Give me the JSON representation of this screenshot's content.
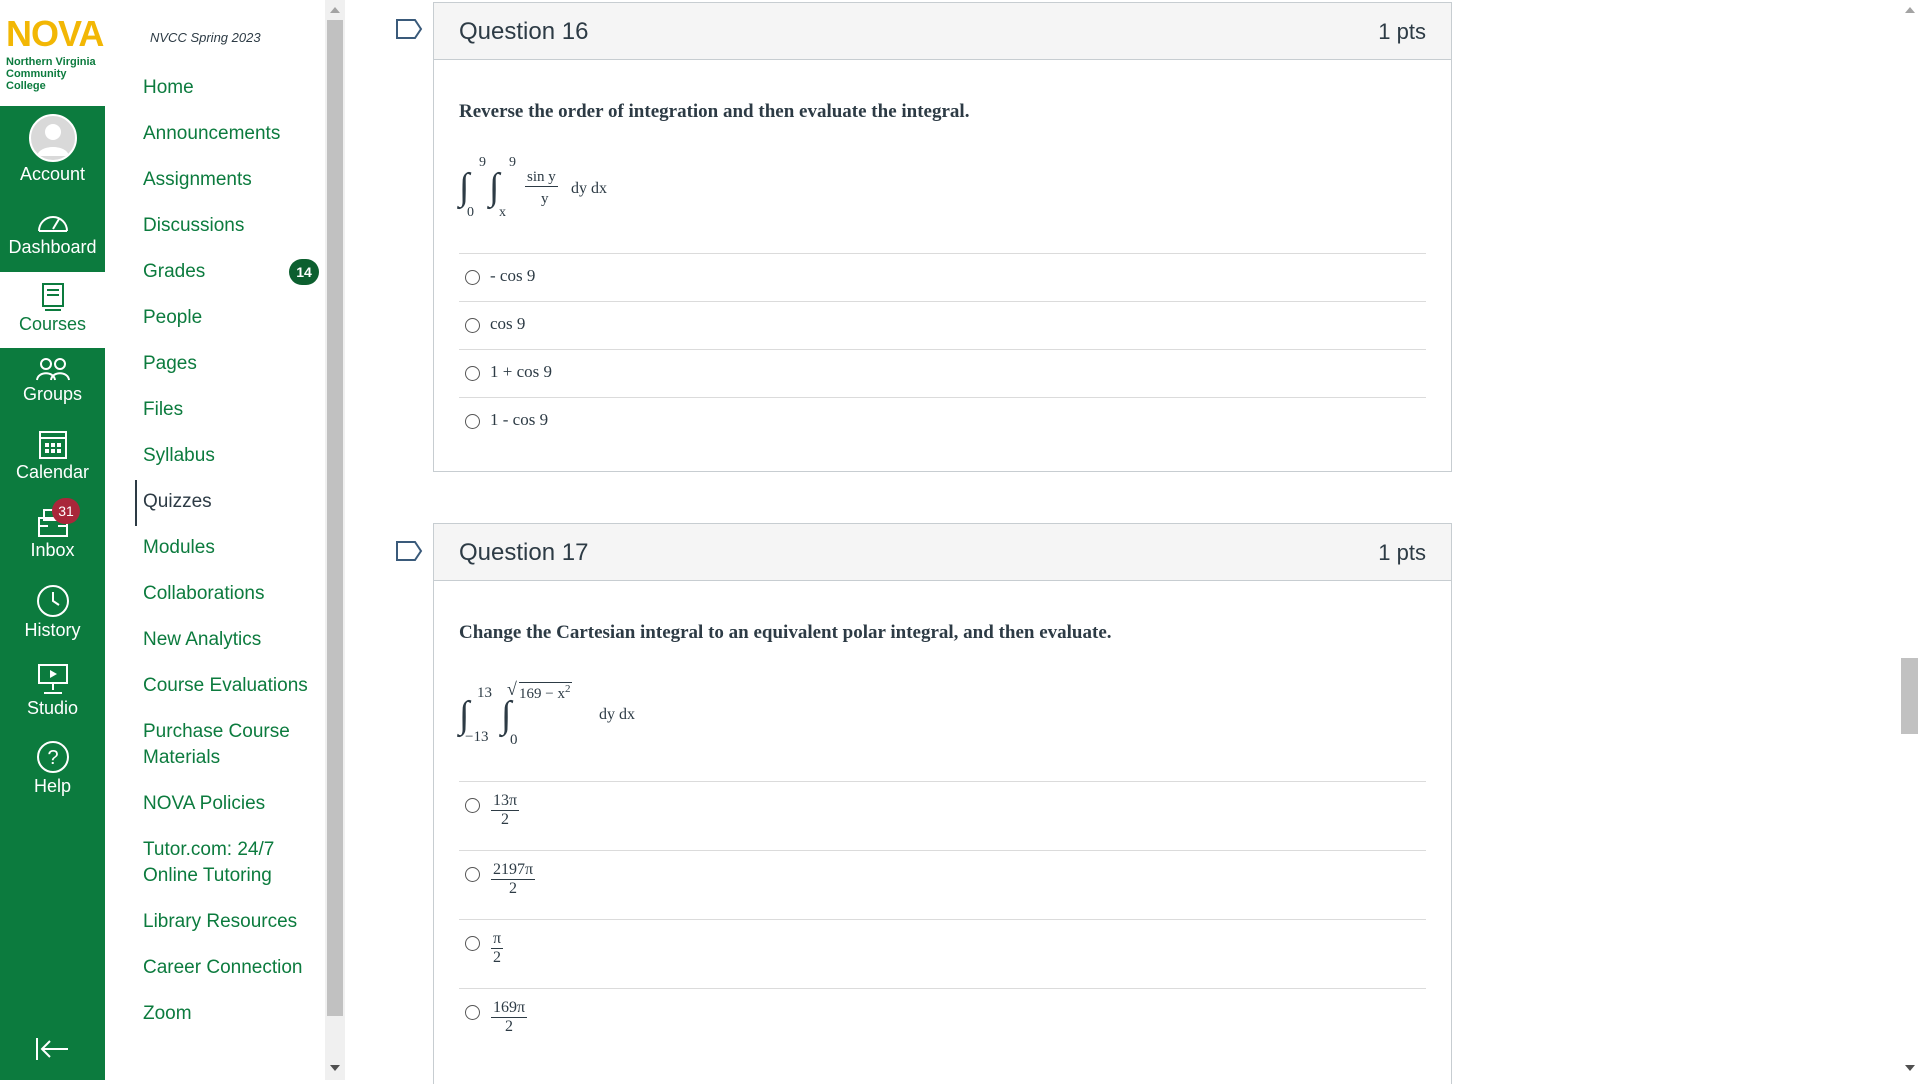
{
  "logo": {
    "name": "NOVA",
    "subtitle": "Northern Virginia Community College"
  },
  "global_nav": {
    "items": [
      {
        "label": "Account",
        "icon": "account-icon"
      },
      {
        "label": "Dashboard",
        "icon": "dashboard-icon"
      },
      {
        "label": "Courses",
        "icon": "courses-icon"
      },
      {
        "label": "Groups",
        "icon": "groups-icon"
      },
      {
        "label": "Calendar",
        "icon": "calendar-icon"
      },
      {
        "label": "Inbox",
        "icon": "inbox-icon",
        "badge": "31"
      },
      {
        "label": "History",
        "icon": "history-icon"
      },
      {
        "label": "Studio",
        "icon": "studio-icon"
      },
      {
        "label": "Help",
        "icon": "help-icon"
      }
    ]
  },
  "course_nav": {
    "term": "NVCC Spring 2023",
    "items": [
      {
        "label": "Home"
      },
      {
        "label": "Announcements"
      },
      {
        "label": "Assignments"
      },
      {
        "label": "Discussions"
      },
      {
        "label": "Grades",
        "badge": "14"
      },
      {
        "label": "People"
      },
      {
        "label": "Pages"
      },
      {
        "label": "Files"
      },
      {
        "label": "Syllabus"
      },
      {
        "label": "Quizzes"
      },
      {
        "label": "Modules"
      },
      {
        "label": "Collaborations"
      },
      {
        "label": "New Analytics"
      },
      {
        "label": "Course Evaluations"
      },
      {
        "label": "Purchase Course Materials"
      },
      {
        "label": "NOVA Policies"
      },
      {
        "label": "Tutor.com: 24/7 Online Tutoring"
      },
      {
        "label": "Library Resources"
      },
      {
        "label": "Career Connection"
      },
      {
        "label": "Zoom"
      }
    ]
  },
  "questions": [
    {
      "title": "Question 16",
      "points": "1 pts",
      "text": "Reverse the order of integration and then evaluate the integral.",
      "formula": {
        "outer_upper": "9",
        "outer_lower": "0",
        "inner_upper": "9",
        "inner_lower": "x",
        "numerator": "sin y",
        "denominator": "y",
        "differentials": "dy dx"
      },
      "answers": [
        "- cos 9",
        "cos 9",
        "1 + cos 9",
        "1 - cos 9"
      ]
    },
    {
      "title": "Question 17",
      "points": "1 pts",
      "text": "Change the Cartesian integral to an equivalent polar integral, and then evaluate.",
      "formula": {
        "outer_upper": "13",
        "outer_lower": "−13",
        "inner_upper": "169 − x",
        "inner_upper_exp": "2",
        "inner_lower": "0",
        "differentials": "dy dx"
      },
      "answers": [
        {
          "num": "13π",
          "den": "2"
        },
        {
          "num": "2197π",
          "den": "2"
        },
        {
          "num": "π",
          "den": "2"
        },
        {
          "num": "169π",
          "den": "2"
        }
      ]
    }
  ],
  "colors": {
    "brand_green": "#0c7b3e",
    "logo_gold": "#f2b705",
    "badge_red": "#a9273a"
  }
}
